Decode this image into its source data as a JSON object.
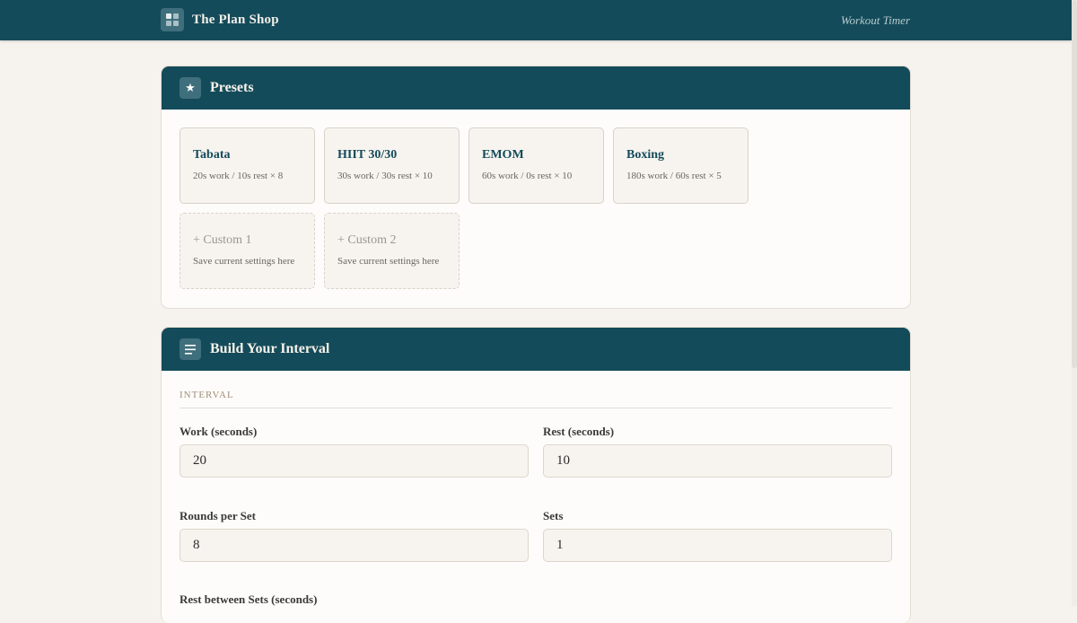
{
  "app": {
    "brand_name": "The Plan Shop",
    "page_label": "Workout Timer"
  },
  "presets_card": {
    "title": "Presets",
    "icon": "star-icon",
    "items": [
      {
        "name": "Tabata",
        "desc": "20s work / 10s rest × 8",
        "custom": false
      },
      {
        "name": "HIIT 30/30",
        "desc": "30s work / 30s rest × 10",
        "custom": false
      },
      {
        "name": "EMOM",
        "desc": "60s work / 0s rest × 10",
        "custom": false
      },
      {
        "name": "Boxing",
        "desc": "180s work / 60s rest × 5",
        "custom": false
      },
      {
        "name": "+ Custom 1",
        "desc": "Save current settings here",
        "custom": true
      },
      {
        "name": "+ Custom 2",
        "desc": "Save current settings here",
        "custom": true
      }
    ]
  },
  "build_card": {
    "title": "Build Your Interval",
    "icon": "list-icon",
    "section_label": "INTERVAL",
    "fields": {
      "work": {
        "label": "Work (seconds)",
        "value": "20"
      },
      "rest": {
        "label": "Rest (seconds)",
        "value": "10"
      },
      "rounds": {
        "label": "Rounds per Set",
        "value": "8"
      },
      "sets": {
        "label": "Sets",
        "value": "1"
      },
      "set_rest": {
        "label": "Rest between Sets (seconds)"
      }
    }
  },
  "colors": {
    "primary": "#144b5a",
    "background": "#f6f3ee",
    "card": "#fdfcfa",
    "accent_muted": "#a08d78"
  }
}
